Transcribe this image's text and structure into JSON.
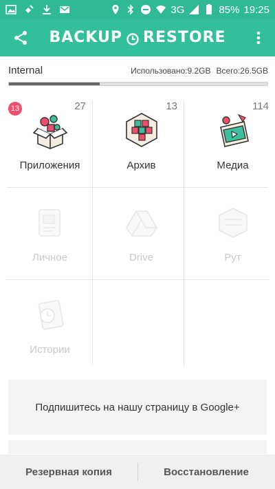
{
  "status_bar": {
    "icons_left": [
      "gallery-icon",
      "satellite-icon",
      "download-icon",
      "mail-icon"
    ],
    "icons_right": [
      "location-icon",
      "bluetooth-icon",
      "do-not-disturb-icon",
      "wifi-icon"
    ],
    "network": "3G",
    "battery": "85%",
    "time": "19:25"
  },
  "app_bar": {
    "title_left": "BACKUP",
    "title_right": "RESTORE",
    "accent": "#33bf9b"
  },
  "storage": {
    "name": "Internal",
    "used": "Использовано:9.2GB",
    "total": "Всего:26.5GB",
    "used_fraction": 0.35
  },
  "categories": [
    {
      "label": "Приложения",
      "count": "27",
      "badge": "13",
      "icon": "apps-box-icon",
      "enabled": true
    },
    {
      "label": "Архив",
      "count": "13",
      "badge": "",
      "icon": "archive-cubes-icon",
      "enabled": true
    },
    {
      "label": "Медиа",
      "count": "114",
      "badge": "",
      "icon": "media-icon",
      "enabled": true
    },
    {
      "label": "Личное",
      "count": "",
      "badge": "",
      "icon": "contacts-icon",
      "enabled": false
    },
    {
      "label": "Drive",
      "count": "",
      "badge": "",
      "icon": "drive-icon",
      "enabled": false
    },
    {
      "label": "Рут",
      "count": "",
      "badge": "",
      "icon": "root-icon",
      "enabled": false
    },
    {
      "label": "Истории",
      "count": "",
      "badge": "",
      "icon": "history-icon",
      "enabled": false
    }
  ],
  "promo": {
    "text": "Подпишитесь на нашу страницу в Google+"
  },
  "bottom_bar": {
    "backup": "Резервная копия",
    "restore": "Восстановление"
  }
}
